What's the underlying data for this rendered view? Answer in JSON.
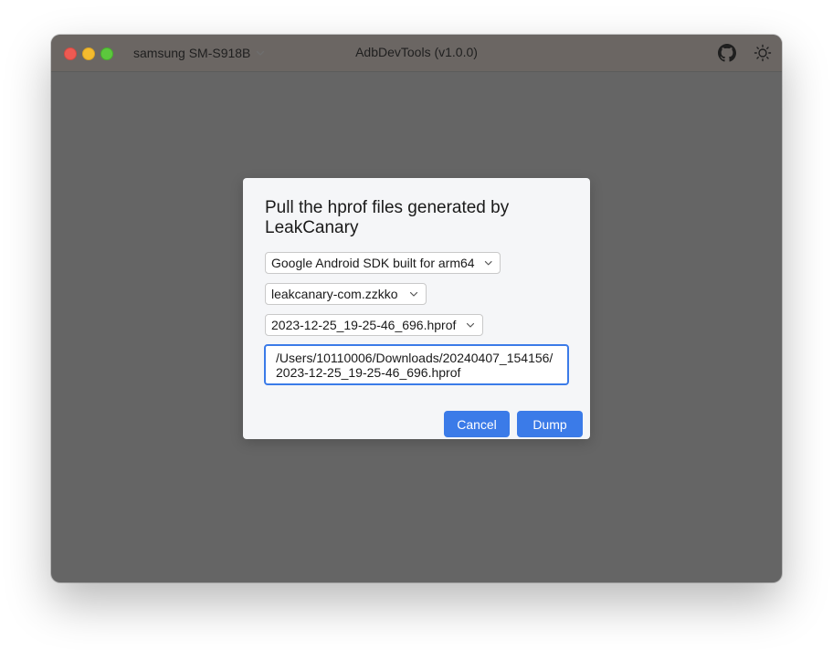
{
  "window": {
    "title": "AdbDevTools (v1.0.0)",
    "device_selector": {
      "label": "samsung SM-S918B",
      "icon": "chevron-down-icon"
    },
    "actions": [
      {
        "icon": "github-icon"
      },
      {
        "icon": "sun-icon"
      }
    ]
  },
  "dialog": {
    "title": "Pull the hprof files generated by LeakCanary",
    "device_dropdown": {
      "value": "Google Android SDK built for arm64"
    },
    "package_dropdown": {
      "value": "leakcanary-com.zzkko"
    },
    "file_dropdown": {
      "value": "2023-12-25_19-25-46_696.hprof"
    },
    "path_input": {
      "value": "/Users/10110006/Downloads/20240407_154156/2023-12-25_19-25-46_696.hprof"
    },
    "buttons": {
      "cancel_label": "Cancel",
      "dump_label": "Dump"
    }
  },
  "colors": {
    "accent": "#3b7be8",
    "overlay": "#656565",
    "dialog_bg": "#f5f6f8"
  }
}
